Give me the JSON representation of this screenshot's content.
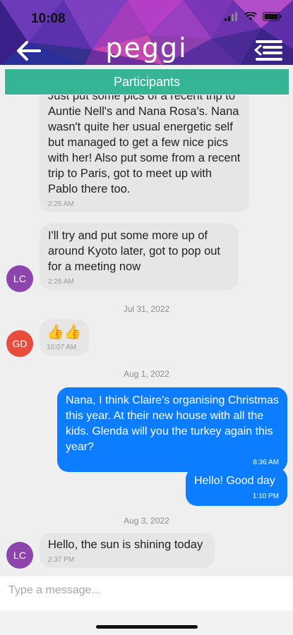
{
  "status_bar": {
    "time": "10:08"
  },
  "header": {
    "brand": "peggi",
    "back_icon": "arrow-left-icon",
    "menu_icon": "menu-collapse-icon"
  },
  "participants": {
    "label": "Participants"
  },
  "messages": [
    {
      "text": "Just put some pics of a recent trip to Auntie Nell's and Nana Rosa's. Nana wasn't quite her usual energetic self but managed to get a few nice pics with her! Also put some from a recent trip to Paris, got to meet up with Pablo there too.",
      "time": "2:25 AM"
    },
    {
      "text": "I'll try and put some more up of around Kyoto later, got to pop out for a meeting now",
      "time": "2:26 AM",
      "avatar": "LC"
    },
    {
      "date": "Jul 31, 2022"
    },
    {
      "text": "👍👍",
      "time": "10:07 AM",
      "avatar": "GD"
    },
    {
      "date": "Aug 1, 2022"
    },
    {
      "text": "Nana, I think Claire's organising Christmas this year. At their new house with all the kids. Glenda will you the turkey again this year?",
      "time": "8:36 AM"
    },
    {
      "text": "Hello! Good day",
      "time": "1:10 PM"
    },
    {
      "date": "Aug 3, 2022"
    },
    {
      "text": "Hello, the sun is shining today",
      "time": "2:37 PM",
      "avatar": "LC"
    }
  ],
  "composer": {
    "placeholder": "Type a message..."
  },
  "colors": {
    "accent_green": "#35b595",
    "outgoing_blue": "#0c7dff",
    "avatar_lc": "#8e44ad",
    "avatar_gd": "#e74c3c"
  }
}
